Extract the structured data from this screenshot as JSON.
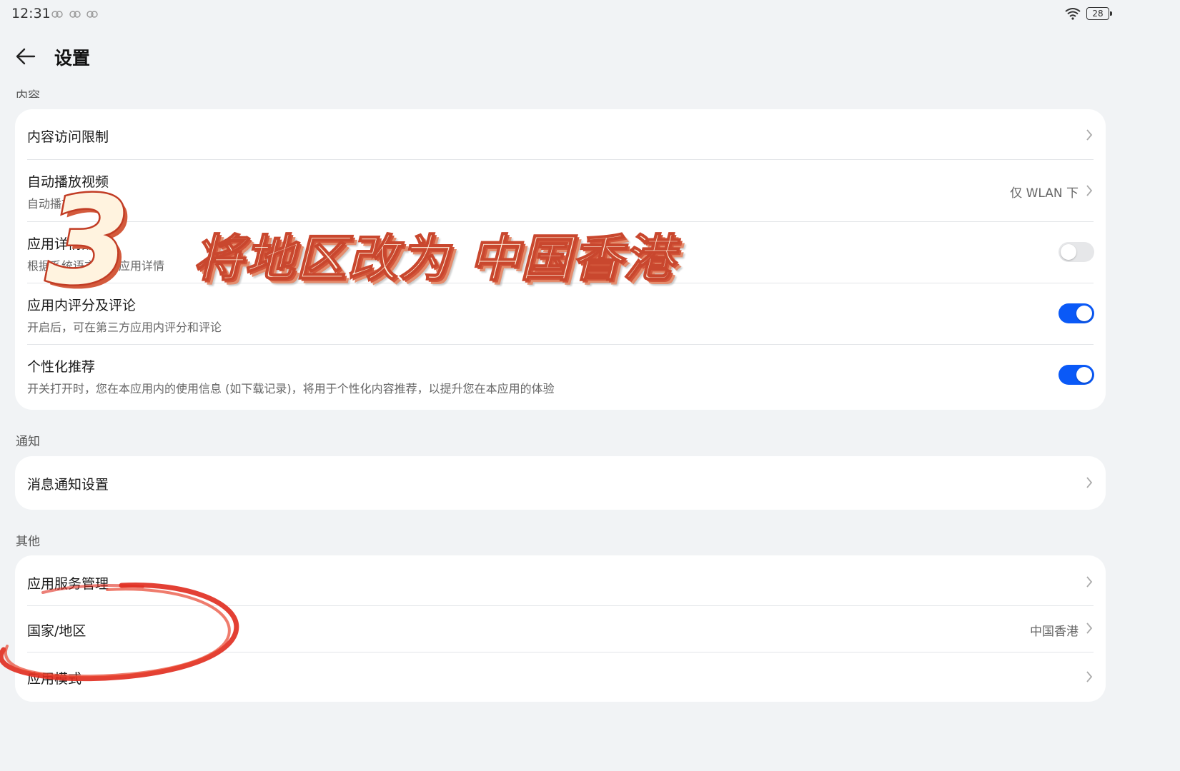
{
  "status_bar": {
    "time": "12:31",
    "battery": "28"
  },
  "header": {
    "title": "设置"
  },
  "sections": {
    "content": {
      "label": "内容",
      "rows": [
        {
          "title": "内容访问限制"
        },
        {
          "title": "自动播放视频",
          "subtitle": "自动播放视频",
          "value": "仅 WLAN 下"
        },
        {
          "title": "应用详情翻译",
          "subtitle": "根据系统语言翻译应用详情"
        },
        {
          "title": "应用内评分及评论",
          "subtitle": "开启后，可在第三方应用内评分和评论"
        },
        {
          "title": "个性化推荐",
          "subtitle": "开关打开时，您在本应用内的使用信息 (如下载记录)，将用于个性化内容推荐，以提升您在本应用的体验"
        }
      ],
      "switch_states": [
        "off",
        "on",
        "on"
      ]
    },
    "notify": {
      "label": "通知",
      "rows": [
        {
          "title": "消息通知设置"
        }
      ]
    },
    "other": {
      "label": "其他",
      "rows": [
        {
          "title": "应用服务管理"
        },
        {
          "title": "国家/地区",
          "value": "中国香港"
        },
        {
          "title": "应用模式"
        }
      ]
    }
  },
  "overlay": {
    "step_number": "3",
    "caption": "将地区改为 中国香港"
  },
  "colors": {
    "accent": "#0a59f7",
    "annotation_red": "#e02b1e",
    "background": "#f1f3f5"
  }
}
